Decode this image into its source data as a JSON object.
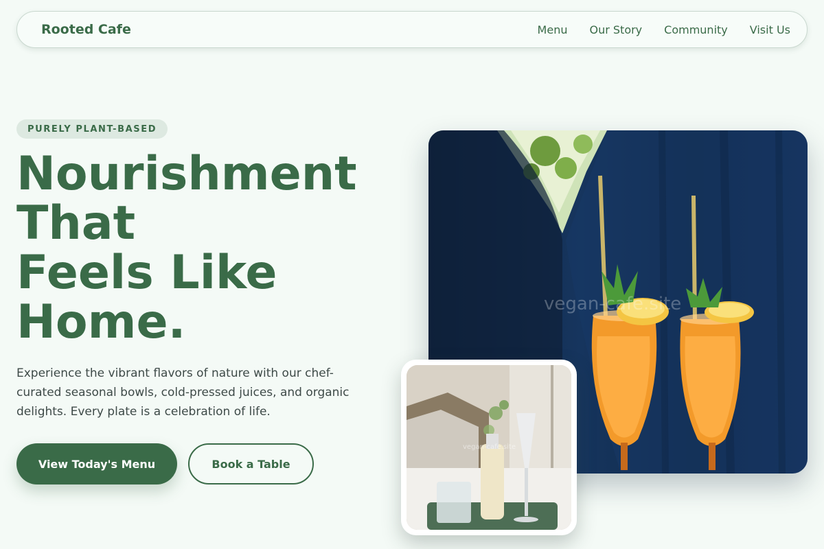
{
  "nav": {
    "brand": "Rooted Cafe",
    "links": [
      "Menu",
      "Our Story",
      "Community",
      "Visit Us"
    ]
  },
  "hero": {
    "badge": "PURELY PLANT-BASED",
    "title_lines": [
      "Nourishment",
      "That",
      "Feels Like",
      "Home."
    ],
    "description": "Experience the vibrant flavors of nature with our chef-curated seasonal bowls, cold-pressed juices, and organic delights. Every plate is a celebration of life.",
    "primary_button": "View Today's Menu",
    "secondary_button": "Book a Table"
  },
  "images": {
    "main_watermark": "vegan-cafe.site",
    "inset_watermark": "vegan-cafe.site"
  },
  "colors": {
    "brand_green": "#3a6b48",
    "background": "#f4faf6",
    "badge_bg": "#dde9e1"
  }
}
